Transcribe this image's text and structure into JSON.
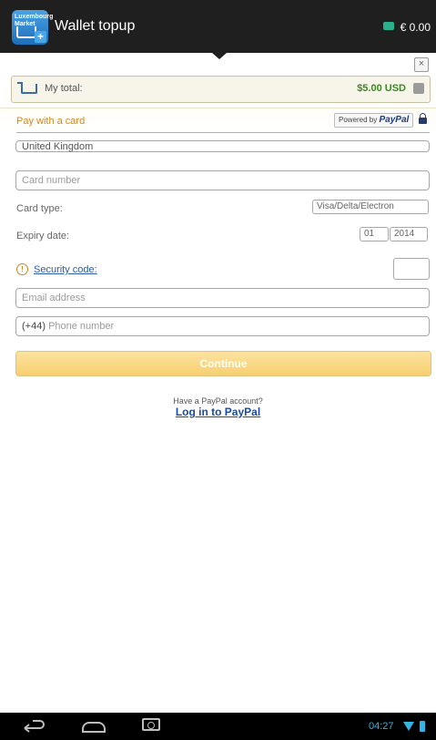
{
  "topbar": {
    "app_icon_text": "Luxembourg Market",
    "title": "Wallet topup",
    "balance": "€ 0.00"
  },
  "close_label": "×",
  "total": {
    "label": "My total:",
    "amount": "$5.00 USD"
  },
  "payment": {
    "title": "Pay with a card",
    "powered_by": "Powered by",
    "paypal_brand": "PayPal"
  },
  "form": {
    "country": "United Kingdom",
    "card_number_placeholder": "Card number",
    "card_type_label": "Card type:",
    "card_type_value": "Visa/Delta/Electron",
    "expiry_label": "Expiry date:",
    "expiry_month": "01",
    "expiry_year": "2014",
    "security_label": "Security code:",
    "email_placeholder": "Email address",
    "phone_prefix": "(+44)",
    "phone_placeholder": "Phone number",
    "continue_label": "Continue"
  },
  "paypal_login": {
    "prompt": "Have a PayPal account?",
    "link": "Log in to PayPal"
  },
  "statusbar": {
    "time": "04:27"
  },
  "colors": {
    "accent_orange": "#d1861b",
    "link_blue": "#1a4b9c",
    "total_green": "#3a8a22",
    "status_blue": "#33b5e5"
  }
}
